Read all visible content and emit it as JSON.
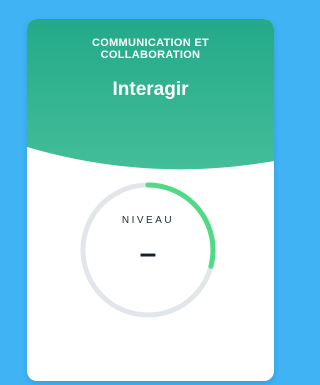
{
  "card": {
    "category": "COMMUNICATION ET\nCOLLABORATION",
    "title": "Interagir",
    "header_color_start": "#23a989",
    "header_color_end": "#43be98",
    "level": {
      "label": "NIVEAU",
      "value": "–",
      "progress_fraction": 0.29,
      "track_color": "#e2e5ea",
      "progress_color": "#52d985"
    }
  }
}
